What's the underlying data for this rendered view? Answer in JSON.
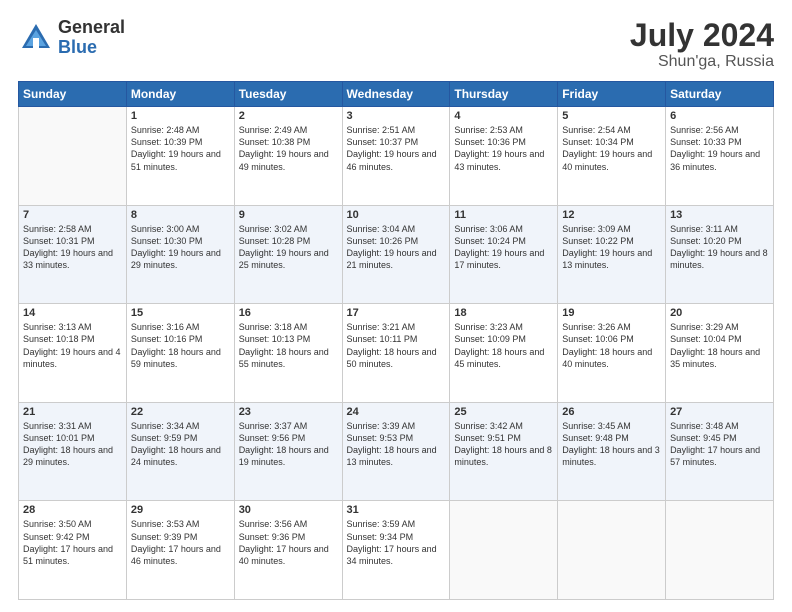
{
  "logo": {
    "general": "General",
    "blue": "Blue"
  },
  "header": {
    "month_year": "July 2024",
    "location": "Shun'ga, Russia"
  },
  "days_of_week": [
    "Sunday",
    "Monday",
    "Tuesday",
    "Wednesday",
    "Thursday",
    "Friday",
    "Saturday"
  ],
  "weeks": [
    [
      {
        "day": "",
        "sunrise": "",
        "sunset": "",
        "daylight": ""
      },
      {
        "day": "1",
        "sunrise": "Sunrise: 2:48 AM",
        "sunset": "Sunset: 10:39 PM",
        "daylight": "Daylight: 19 hours and 51 minutes."
      },
      {
        "day": "2",
        "sunrise": "Sunrise: 2:49 AM",
        "sunset": "Sunset: 10:38 PM",
        "daylight": "Daylight: 19 hours and 49 minutes."
      },
      {
        "day": "3",
        "sunrise": "Sunrise: 2:51 AM",
        "sunset": "Sunset: 10:37 PM",
        "daylight": "Daylight: 19 hours and 46 minutes."
      },
      {
        "day": "4",
        "sunrise": "Sunrise: 2:53 AM",
        "sunset": "Sunset: 10:36 PM",
        "daylight": "Daylight: 19 hours and 43 minutes."
      },
      {
        "day": "5",
        "sunrise": "Sunrise: 2:54 AM",
        "sunset": "Sunset: 10:34 PM",
        "daylight": "Daylight: 19 hours and 40 minutes."
      },
      {
        "day": "6",
        "sunrise": "Sunrise: 2:56 AM",
        "sunset": "Sunset: 10:33 PM",
        "daylight": "Daylight: 19 hours and 36 minutes."
      }
    ],
    [
      {
        "day": "7",
        "sunrise": "Sunrise: 2:58 AM",
        "sunset": "Sunset: 10:31 PM",
        "daylight": "Daylight: 19 hours and 33 minutes."
      },
      {
        "day": "8",
        "sunrise": "Sunrise: 3:00 AM",
        "sunset": "Sunset: 10:30 PM",
        "daylight": "Daylight: 19 hours and 29 minutes."
      },
      {
        "day": "9",
        "sunrise": "Sunrise: 3:02 AM",
        "sunset": "Sunset: 10:28 PM",
        "daylight": "Daylight: 19 hours and 25 minutes."
      },
      {
        "day": "10",
        "sunrise": "Sunrise: 3:04 AM",
        "sunset": "Sunset: 10:26 PM",
        "daylight": "Daylight: 19 hours and 21 minutes."
      },
      {
        "day": "11",
        "sunrise": "Sunrise: 3:06 AM",
        "sunset": "Sunset: 10:24 PM",
        "daylight": "Daylight: 19 hours and 17 minutes."
      },
      {
        "day": "12",
        "sunrise": "Sunrise: 3:09 AM",
        "sunset": "Sunset: 10:22 PM",
        "daylight": "Daylight: 19 hours and 13 minutes."
      },
      {
        "day": "13",
        "sunrise": "Sunrise: 3:11 AM",
        "sunset": "Sunset: 10:20 PM",
        "daylight": "Daylight: 19 hours and 8 minutes."
      }
    ],
    [
      {
        "day": "14",
        "sunrise": "Sunrise: 3:13 AM",
        "sunset": "Sunset: 10:18 PM",
        "daylight": "Daylight: 19 hours and 4 minutes."
      },
      {
        "day": "15",
        "sunrise": "Sunrise: 3:16 AM",
        "sunset": "Sunset: 10:16 PM",
        "daylight": "Daylight: 18 hours and 59 minutes."
      },
      {
        "day": "16",
        "sunrise": "Sunrise: 3:18 AM",
        "sunset": "Sunset: 10:13 PM",
        "daylight": "Daylight: 18 hours and 55 minutes."
      },
      {
        "day": "17",
        "sunrise": "Sunrise: 3:21 AM",
        "sunset": "Sunset: 10:11 PM",
        "daylight": "Daylight: 18 hours and 50 minutes."
      },
      {
        "day": "18",
        "sunrise": "Sunrise: 3:23 AM",
        "sunset": "Sunset: 10:09 PM",
        "daylight": "Daylight: 18 hours and 45 minutes."
      },
      {
        "day": "19",
        "sunrise": "Sunrise: 3:26 AM",
        "sunset": "Sunset: 10:06 PM",
        "daylight": "Daylight: 18 hours and 40 minutes."
      },
      {
        "day": "20",
        "sunrise": "Sunrise: 3:29 AM",
        "sunset": "Sunset: 10:04 PM",
        "daylight": "Daylight: 18 hours and 35 minutes."
      }
    ],
    [
      {
        "day": "21",
        "sunrise": "Sunrise: 3:31 AM",
        "sunset": "Sunset: 10:01 PM",
        "daylight": "Daylight: 18 hours and 29 minutes."
      },
      {
        "day": "22",
        "sunrise": "Sunrise: 3:34 AM",
        "sunset": "Sunset: 9:59 PM",
        "daylight": "Daylight: 18 hours and 24 minutes."
      },
      {
        "day": "23",
        "sunrise": "Sunrise: 3:37 AM",
        "sunset": "Sunset: 9:56 PM",
        "daylight": "Daylight: 18 hours and 19 minutes."
      },
      {
        "day": "24",
        "sunrise": "Sunrise: 3:39 AM",
        "sunset": "Sunset: 9:53 PM",
        "daylight": "Daylight: 18 hours and 13 minutes."
      },
      {
        "day": "25",
        "sunrise": "Sunrise: 3:42 AM",
        "sunset": "Sunset: 9:51 PM",
        "daylight": "Daylight: 18 hours and 8 minutes."
      },
      {
        "day": "26",
        "sunrise": "Sunrise: 3:45 AM",
        "sunset": "Sunset: 9:48 PM",
        "daylight": "Daylight: 18 hours and 3 minutes."
      },
      {
        "day": "27",
        "sunrise": "Sunrise: 3:48 AM",
        "sunset": "Sunset: 9:45 PM",
        "daylight": "Daylight: 17 hours and 57 minutes."
      }
    ],
    [
      {
        "day": "28",
        "sunrise": "Sunrise: 3:50 AM",
        "sunset": "Sunset: 9:42 PM",
        "daylight": "Daylight: 17 hours and 51 minutes."
      },
      {
        "day": "29",
        "sunrise": "Sunrise: 3:53 AM",
        "sunset": "Sunset: 9:39 PM",
        "daylight": "Daylight: 17 hours and 46 minutes."
      },
      {
        "day": "30",
        "sunrise": "Sunrise: 3:56 AM",
        "sunset": "Sunset: 9:36 PM",
        "daylight": "Daylight: 17 hours and 40 minutes."
      },
      {
        "day": "31",
        "sunrise": "Sunrise: 3:59 AM",
        "sunset": "Sunset: 9:34 PM",
        "daylight": "Daylight: 17 hours and 34 minutes."
      },
      {
        "day": "",
        "sunrise": "",
        "sunset": "",
        "daylight": ""
      },
      {
        "day": "",
        "sunrise": "",
        "sunset": "",
        "daylight": ""
      },
      {
        "day": "",
        "sunrise": "",
        "sunset": "",
        "daylight": ""
      }
    ]
  ]
}
